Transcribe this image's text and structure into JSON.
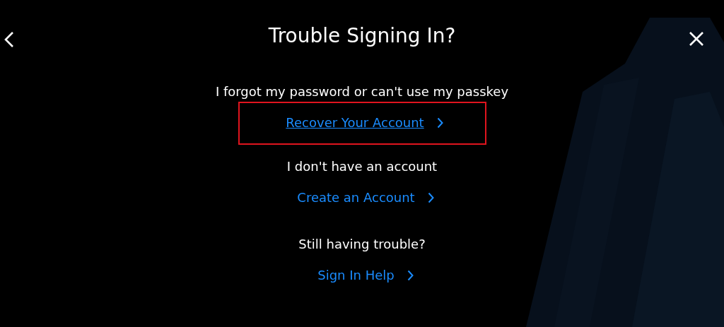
{
  "title": "Trouble Signing In?",
  "options": [
    {
      "prompt": "I forgot my password or can't use my passkey",
      "link": "Recover Your Account",
      "highlighted": true
    },
    {
      "prompt": "I don't have an account",
      "link": "Create an Account",
      "highlighted": false
    },
    {
      "prompt": "Still having trouble?",
      "link": "Sign In Help",
      "highlighted": false
    }
  ]
}
